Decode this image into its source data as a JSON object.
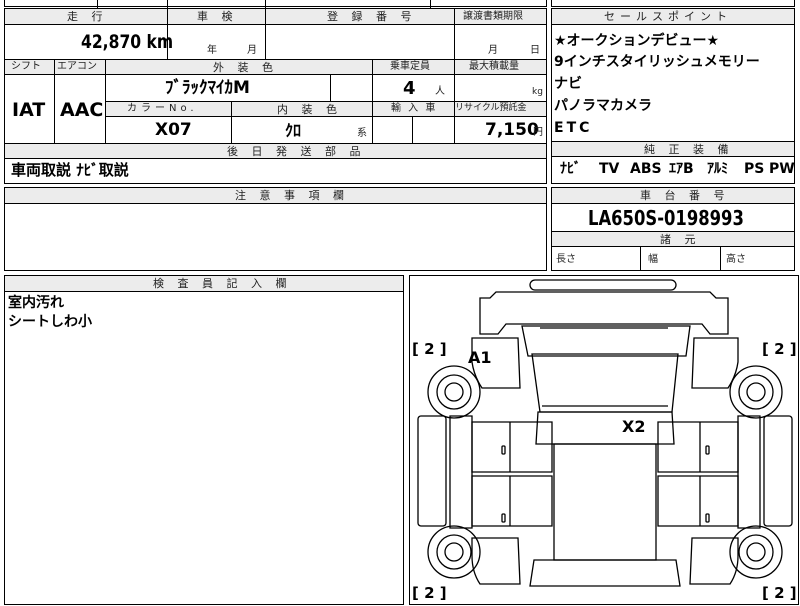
{
  "top_fragments": {
    "inspection_top": "",
    "second": ""
  },
  "mileage": {
    "label": "走 行",
    "value": "42,870",
    "unit": "km"
  },
  "inspection": {
    "label": "車 検",
    "year": "年",
    "month": "月"
  },
  "registration": {
    "label": "登 録 番 号",
    "value": ""
  },
  "transfer": {
    "label": "譲渡書類期限",
    "month": "月",
    "day": "日"
  },
  "shift": {
    "label": "シフト",
    "value": "IAT"
  },
  "aircon": {
    "label": "エアコン",
    "value": "AAC"
  },
  "exterior_color": {
    "label": "外 装 色",
    "value": "ﾌﾞﾗｯｸﾏｲｶM"
  },
  "capacity": {
    "label": "乗車定員",
    "value": "4",
    "unit": "人"
  },
  "max_load": {
    "label": "最大積載量",
    "unit": "kg"
  },
  "color_no": {
    "label": "カラーNo.",
    "value": "X07"
  },
  "interior_color": {
    "label": "内 装 色",
    "value": "ｸﾛ",
    "suffix": "系"
  },
  "import": {
    "label": "輸 入 車"
  },
  "recycle": {
    "label": "リサイクル預託金",
    "value": "7,150",
    "unit": "円"
  },
  "later_parts": {
    "label": "後 日 発 送 部 品",
    "value": "車両取説 ﾅﾋﾞ取説"
  },
  "notes": {
    "label": "注 意 事 項 欄"
  },
  "selling_points": {
    "label": "セールスポイント",
    "items": [
      "★オークションデビュー★",
      "9インチスタイリッシュメモリー",
      "ナビ",
      "パノラマカメラ",
      "ETC"
    ]
  },
  "equipment": {
    "label": "純 正 装 備",
    "items": [
      "ﾅﾋﾞ",
      "TV",
      "ABS",
      "ｴｱB",
      "ｱﾙﾐ",
      "PS",
      "PW"
    ]
  },
  "chassis": {
    "label": "車 台 番 号",
    "value": "LA650S-0198993"
  },
  "dimensions": {
    "label": "諸 元",
    "length": "長さ",
    "width": "幅",
    "height": "高さ"
  },
  "inspector": {
    "label": "検 査 員 記 入 欄",
    "lines": [
      "室内汚れ",
      "シートしわ小"
    ]
  },
  "diagram": {
    "tire_marks": [
      "[ 2 ]",
      "[ 2 ]",
      "[ 2 ]",
      "[ 2 ]"
    ],
    "damage": [
      {
        "code": "A1"
      },
      {
        "code": "X2"
      }
    ]
  }
}
